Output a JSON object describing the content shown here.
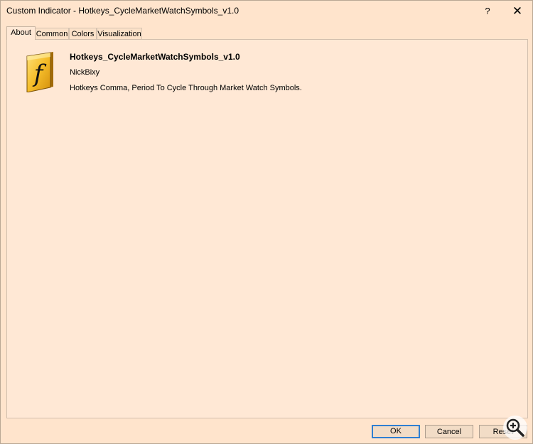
{
  "window": {
    "title": "Custom Indicator - Hotkeys_CycleMarketWatchSymbols_v1.0",
    "help_label": "?",
    "close_label": "✕"
  },
  "tabs": [
    {
      "label": "About",
      "active": true
    },
    {
      "label": "Common",
      "active": false
    },
    {
      "label": "Colors",
      "active": false
    },
    {
      "label": "Visualization",
      "active": false
    }
  ],
  "about": {
    "icon": "function-f-icon",
    "name": "Hotkeys_CycleMarketWatchSymbols_v1.0",
    "author": "NickBixy",
    "description": "Hotkeys Comma, Period To Cycle Through Market Watch Symbols."
  },
  "buttons": {
    "ok": "OK",
    "cancel": "Cancel",
    "reset": "Reset"
  },
  "overlay": {
    "icon": "zoom-in-icon"
  },
  "colors": {
    "background": "#ffe4cc",
    "focus_border": "#2f7fd2",
    "icon_gold": "#f2b51c"
  }
}
